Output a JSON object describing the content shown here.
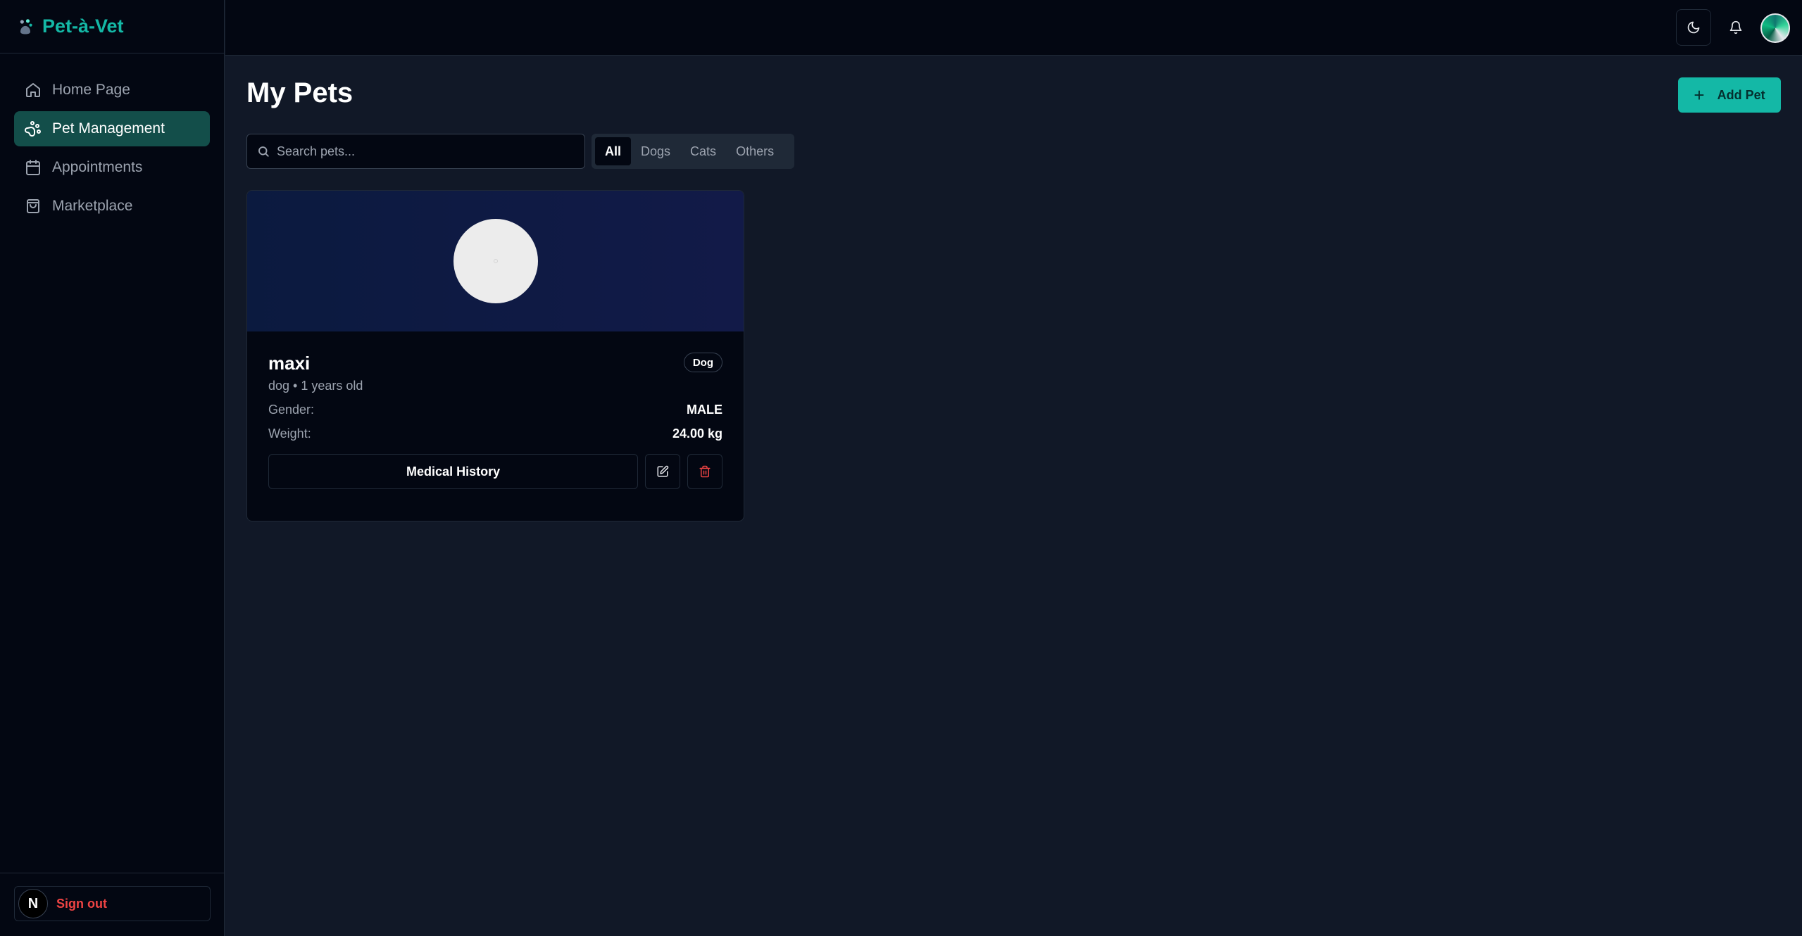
{
  "brand": {
    "name": "Pet-à-Vet",
    "logo_icon": "paw-logo-icon",
    "accent": "#14b8a6"
  },
  "sidebar": {
    "items": [
      {
        "label": "Home Page",
        "icon": "home-icon",
        "active": false
      },
      {
        "label": "Pet Management",
        "icon": "paw-icon",
        "active": true
      },
      {
        "label": "Appointments",
        "icon": "calendar-icon",
        "active": false
      },
      {
        "label": "Marketplace",
        "icon": "shopping-bag-icon",
        "active": false
      }
    ],
    "footer": {
      "avatar_letter": "N",
      "signout_label": "Sign out"
    }
  },
  "topbar": {
    "theme_icon": "moon-icon",
    "notification_icon": "bell-icon"
  },
  "main": {
    "title": "My Pets",
    "add_button": {
      "icon": "plus-icon",
      "label": "Add Pet"
    },
    "search": {
      "placeholder": "Search pets...",
      "value": ""
    },
    "filters": [
      {
        "label": "All",
        "active": true
      },
      {
        "label": "Dogs",
        "active": false
      },
      {
        "label": "Cats",
        "active": false
      },
      {
        "label": "Others",
        "active": false
      }
    ],
    "pets": [
      {
        "name": "maxi",
        "subtitle": "dog • 1 years old",
        "badge": "Dog",
        "details": [
          {
            "key": "Gender:",
            "value": "MALE"
          },
          {
            "key": "Weight:",
            "value": "24.00 kg"
          }
        ],
        "medical_button": "Medical History",
        "edit_icon": "edit-icon",
        "delete_icon": "trash-icon"
      }
    ]
  }
}
